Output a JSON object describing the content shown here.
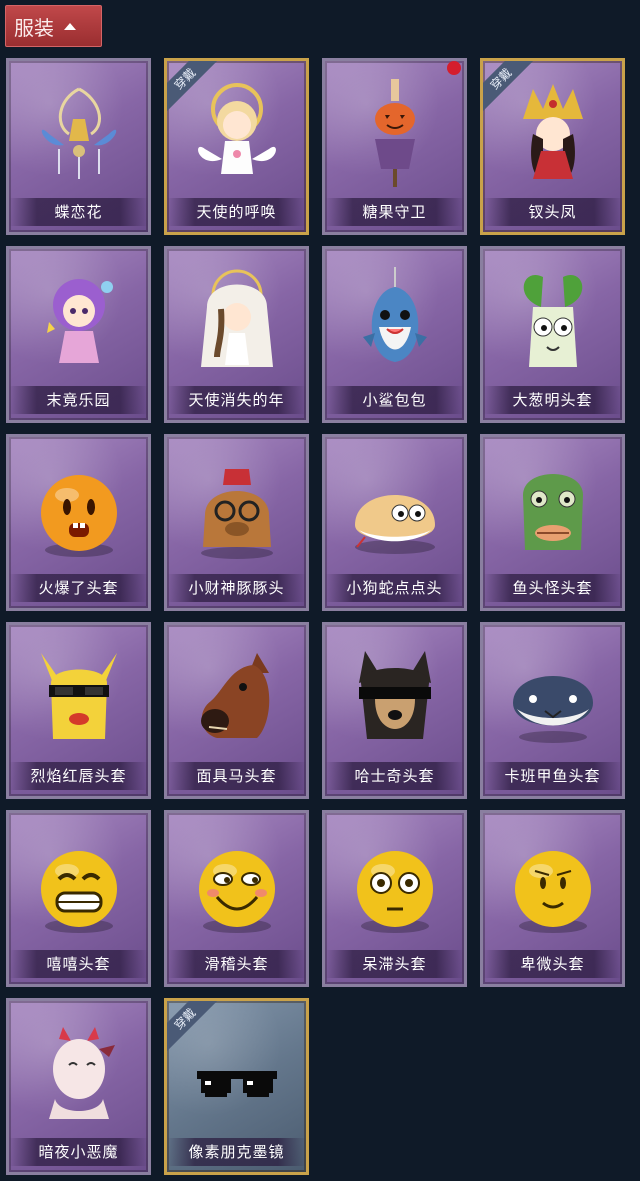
{
  "header": {
    "title": "服装"
  },
  "badge_text": "穿戴",
  "colors": {
    "accent_red": "#b03a3c",
    "card_purple": "#8766a6",
    "equipped_gold": "#c9a24a",
    "dot_red": "#d41e2d"
  },
  "items": [
    {
      "name": "蝶恋花",
      "icon": "butterfly-bell-pendant-icon",
      "equipped": false,
      "dot": false,
      "style": "purple"
    },
    {
      "name": "天使的呼唤",
      "icon": "angel-doll-icon",
      "equipped": true,
      "dot": false,
      "style": "purple"
    },
    {
      "name": "糖果守卫",
      "icon": "pumpkin-scarecrow-pendant-icon",
      "equipped": false,
      "dot": true,
      "style": "purple"
    },
    {
      "name": "钗头凤",
      "icon": "phoenix-crown-doll-icon",
      "equipped": true,
      "dot": false,
      "style": "purple"
    },
    {
      "name": "末竟乐园",
      "icon": "purple-hair-doll-icon",
      "equipped": false,
      "dot": false,
      "style": "purple"
    },
    {
      "name": "天使消失的年",
      "icon": "veiled-angel-doll-icon",
      "equipped": false,
      "dot": false,
      "style": "purple"
    },
    {
      "name": "小鲨包包",
      "icon": "shark-bag-icon",
      "equipped": false,
      "dot": false,
      "style": "purple"
    },
    {
      "name": "大葱明头套",
      "icon": "scallion-head-icon",
      "equipped": false,
      "dot": false,
      "style": "purple"
    },
    {
      "name": "火爆了头套",
      "icon": "fireball-head-icon",
      "equipped": false,
      "dot": false,
      "style": "purple"
    },
    {
      "name": "小财神豚豚头",
      "icon": "capybara-head-icon",
      "equipped": false,
      "dot": false,
      "style": "purple"
    },
    {
      "name": "小狗蛇点点头",
      "icon": "dog-snake-head-icon",
      "equipped": false,
      "dot": false,
      "style": "purple"
    },
    {
      "name": "鱼头怪头套",
      "icon": "fish-head-icon",
      "equipped": false,
      "dot": false,
      "style": "purple"
    },
    {
      "name": "烈焰红唇头套",
      "icon": "yellow-mask-sunglasses-icon",
      "equipped": false,
      "dot": false,
      "style": "purple"
    },
    {
      "name": "面具马头套",
      "icon": "horse-mask-icon",
      "equipped": false,
      "dot": false,
      "style": "purple"
    },
    {
      "name": "哈士奇头套",
      "icon": "husky-sunglasses-head-icon",
      "equipped": false,
      "dot": false,
      "style": "purple"
    },
    {
      "name": "卡班甲鱼头套",
      "icon": "fish-ball-head-icon",
      "equipped": false,
      "dot": false,
      "style": "purple"
    },
    {
      "name": "嘻嘻头套",
      "icon": "grin-emoji-head-icon",
      "equipped": false,
      "dot": false,
      "style": "purple"
    },
    {
      "name": "滑稽头套",
      "icon": "funny-emoji-head-icon",
      "equipped": false,
      "dot": false,
      "style": "purple"
    },
    {
      "name": "呆滞头套",
      "icon": "dazed-emoji-head-icon",
      "equipped": false,
      "dot": false,
      "style": "purple"
    },
    {
      "name": "卑微头套",
      "icon": "humble-emoji-head-icon",
      "equipped": false,
      "dot": false,
      "style": "purple"
    },
    {
      "name": "暗夜小恶魔",
      "icon": "little-devil-head-icon",
      "equipped": false,
      "dot": false,
      "style": "purple"
    },
    {
      "name": "像素朋克墨镜",
      "icon": "pixel-sunglasses-icon",
      "equipped": true,
      "dot": false,
      "style": "blue"
    }
  ]
}
